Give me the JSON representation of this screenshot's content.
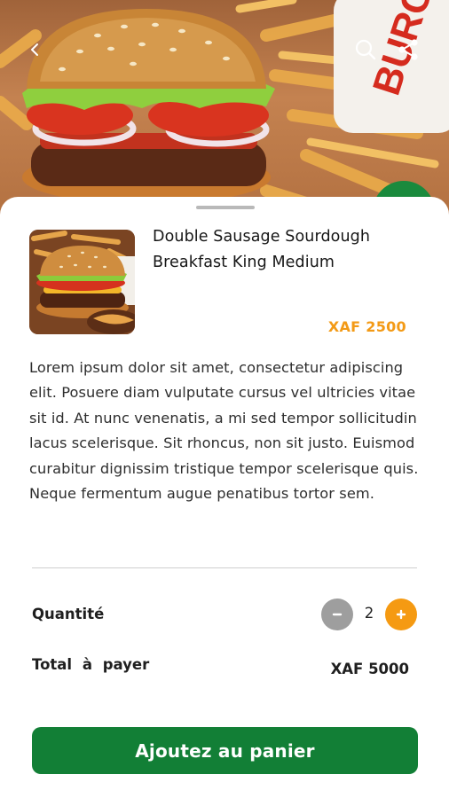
{
  "header": {
    "icons": [
      "back-arrow-icon",
      "search-icon",
      "share-icon"
    ],
    "photo_brand_text": "BURG"
  },
  "product": {
    "name_line1": "Double Sausage Sourdough",
    "name_line2": "Breakfast King Medium",
    "price": "XAF 2500",
    "description": "Lorem ipsum dolor sit amet, consectetur adipiscing elit. Posuere diam vulputate cursus vel ultricies vitae sit id. At nunc venenatis, a mi sed tempor sollicitudin lacus scelerisque. Sit rhoncus, non sit justo. Euismod curabitur dignissim tristique tempor scelerisque quis. Neque fermentum augue penatibus tortor sem."
  },
  "order": {
    "quantity_label": "Quantité",
    "quantity": "2",
    "total_label": "Total à payer",
    "total_value": "XAF 5000"
  },
  "actions": {
    "add_to_cart_label": "Ajoutez au panier"
  },
  "colors": {
    "accent_orange": "#f59a12",
    "primary_green": "#127f36",
    "muted_gray": "#9e9e9e"
  }
}
